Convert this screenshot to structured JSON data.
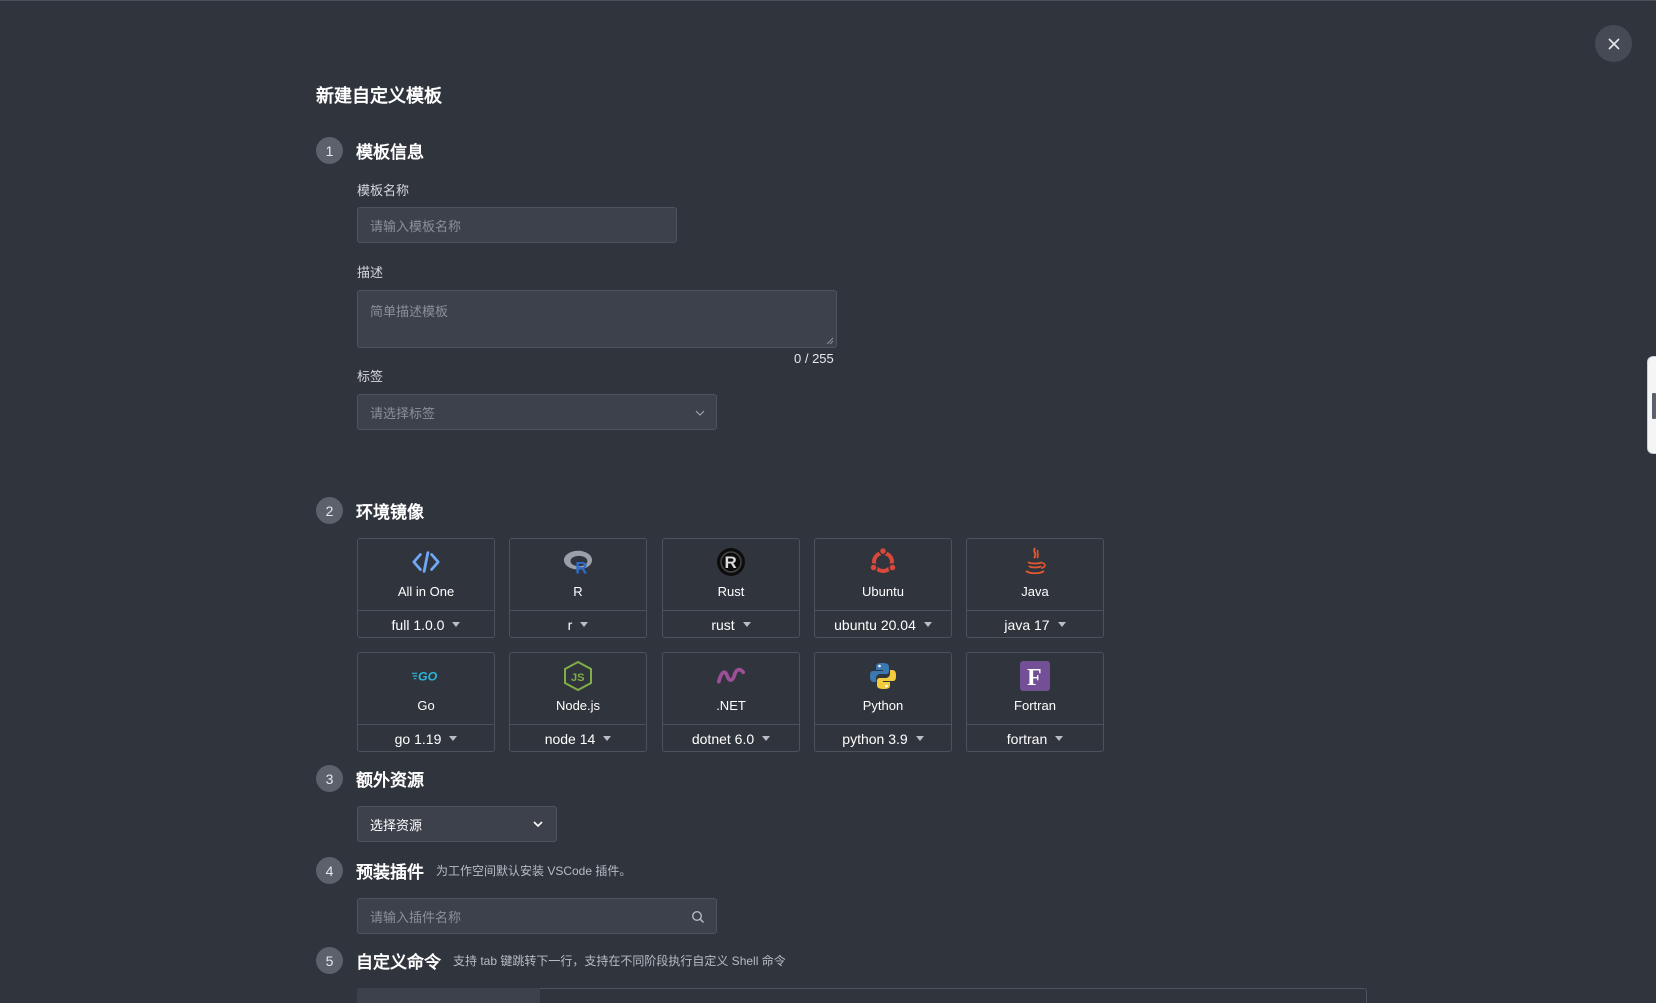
{
  "page": {
    "title": "新建自定义模板"
  },
  "steps": {
    "s1": {
      "num": "1",
      "title": "模板信息"
    },
    "s2": {
      "num": "2",
      "title": "环境镜像"
    },
    "s3": {
      "num": "3",
      "title": "额外资源"
    },
    "s4": {
      "num": "4",
      "title": "预装插件",
      "hint": "为工作空间默认安装 VSCode 插件。"
    },
    "s5": {
      "num": "5",
      "title": "自定义命令",
      "hint": "支持 tab 键跳转下一行，支持在不同阶段执行自定义 Shell 命令"
    }
  },
  "form": {
    "name_label": "模板名称",
    "name_placeholder": "请输入模板名称",
    "desc_label": "描述",
    "desc_placeholder": "简单描述模板",
    "desc_counter": "0 / 255",
    "tag_label": "标签",
    "tag_placeholder": "请选择标签"
  },
  "images": [
    {
      "name": "All in One",
      "version": "full 1.0.0",
      "icon": "code-icon"
    },
    {
      "name": "R",
      "version": "r",
      "icon": "r-logo-icon"
    },
    {
      "name": "Rust",
      "version": "rust",
      "icon": "rust-logo-icon"
    },
    {
      "name": "Ubuntu",
      "version": "ubuntu 20.04",
      "icon": "ubuntu-logo-icon"
    },
    {
      "name": "Java",
      "version": "java 17",
      "icon": "java-logo-icon"
    },
    {
      "name": "Go",
      "version": "go 1.19",
      "icon": "go-logo-icon"
    },
    {
      "name": "Node.js",
      "version": "node 14",
      "icon": "nodejs-logo-icon"
    },
    {
      "name": ".NET",
      "version": "dotnet 6.0",
      "icon": "dotnet-logo-icon"
    },
    {
      "name": "Python",
      "version": "python 3.9",
      "icon": "python-logo-icon"
    },
    {
      "name": "Fortran",
      "version": "fortran",
      "icon": "fortran-logo-icon"
    }
  ],
  "resources": {
    "select_label": "选择资源"
  },
  "plugins": {
    "search_placeholder": "请输入插件名称"
  },
  "colors": {
    "background": "#30343d",
    "input_bg": "#3d414b",
    "border": "#4e535e",
    "step_badge": "#5c616c"
  }
}
